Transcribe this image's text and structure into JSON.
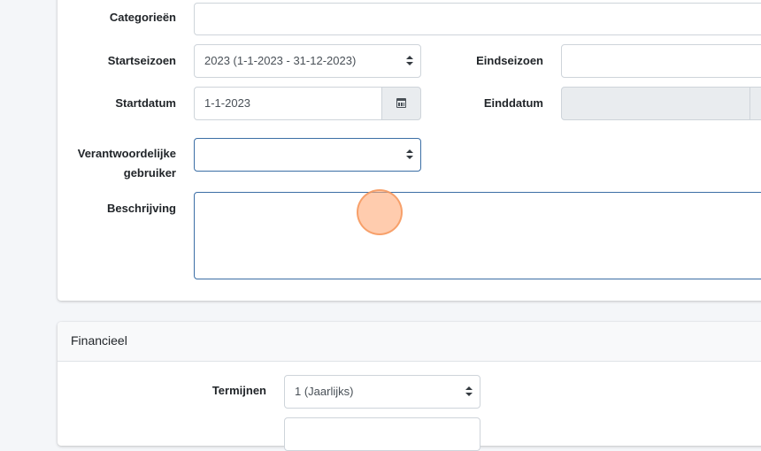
{
  "general": {
    "categories_label": "Categorieën",
    "startseason_label": "Startseizoen",
    "startseason_value": "2023 (1-1-2023 - 31-12-2023)",
    "endseason_label": "Eindseizoen",
    "startdate_label": "Startdatum",
    "startdate_value": "1-1-2023",
    "enddate_label": "Einddatum",
    "responsible_label_1": "Verantwoordelijke",
    "responsible_label_2": "gebruiker",
    "description_label": "Beschrijving"
  },
  "financial": {
    "title": "Financieel",
    "terms_label": "Termijnen",
    "terms_value": "1 (Jaarlijks)"
  },
  "icons": {
    "calendar": "calendar-icon",
    "select_caret": "chevron-up-down-icon"
  }
}
